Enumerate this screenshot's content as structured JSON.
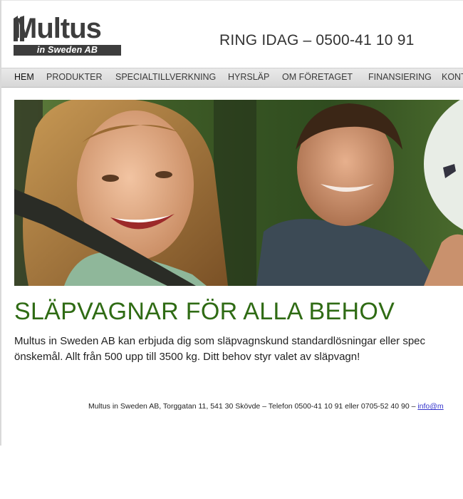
{
  "header": {
    "logo_name": "Multus",
    "logo_tagline": "in Sweden AB",
    "phone_text": "RING IDAG – 0500-41 10 91"
  },
  "nav": {
    "items": [
      {
        "label": "HEM",
        "active": true
      },
      {
        "label": "PRODUKTER"
      },
      {
        "label": "SPECIALTILLVERKNING"
      },
      {
        "label": "HYRSLÄP"
      },
      {
        "label": "OM FÖRETAGET"
      },
      {
        "label": "FINANSIERING"
      },
      {
        "label": "KONT"
      }
    ]
  },
  "main": {
    "headline": "SLÄPVAGNAR FÖR ALLA BEHOV",
    "intro_line1": "Multus in Sweden AB kan erbjuda dig som släpvagnskund standardlösningar eller spec",
    "intro_line2": "önskemål. Allt från 500 upp till 3500 kg. Ditt behov styr valet av släpvagn!"
  },
  "footer": {
    "text": "Multus in Sweden AB, Torggatan 11, 541 30 Skövde – Telefon 0500-41 10 91 eller 0705-52 40 90 – ",
    "email": "info@m"
  },
  "colors": {
    "headline": "#2f6b14",
    "nav_bg": "#dcdcdc",
    "logo": "#3d3d3d",
    "link": "#3333cc"
  }
}
